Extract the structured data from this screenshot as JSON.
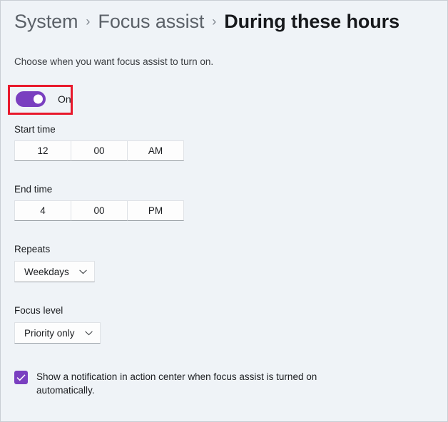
{
  "breadcrumb": {
    "separator": "›",
    "items": [
      {
        "label": "System",
        "current": false
      },
      {
        "label": "Focus assist",
        "current": false
      },
      {
        "label": "During these hours",
        "current": true
      }
    ]
  },
  "subtitle": "Choose when you want focus assist to turn on.",
  "toggle": {
    "state_label": "On",
    "checked": true,
    "accent_color": "#7a3fc0",
    "highlight_color": "#e8192c"
  },
  "start_time": {
    "label": "Start time",
    "hour": "12",
    "minute": "00",
    "meridiem": "AM"
  },
  "end_time": {
    "label": "End time",
    "hour": "4",
    "minute": "00",
    "meridiem": "PM"
  },
  "repeats": {
    "label": "Repeats",
    "value": "Weekdays"
  },
  "focus_level": {
    "label": "Focus level",
    "value": "Priority only"
  },
  "notification_checkbox": {
    "checked": true,
    "label": "Show a notification in action center when focus assist is turned on automatically."
  }
}
